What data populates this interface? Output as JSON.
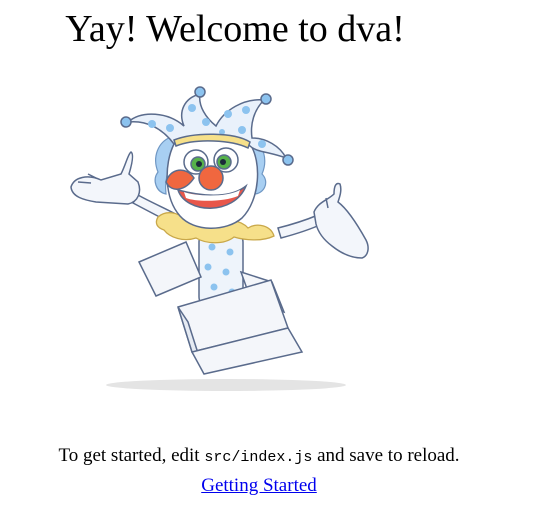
{
  "page": {
    "title": "Yay! Welcome to dva!"
  },
  "intro": {
    "prefix": "To get started, edit ",
    "code": "src/index.js",
    "suffix": " and save to reload."
  },
  "link": {
    "label": "Getting Started"
  },
  "illustration": {
    "icon": "jester-in-box-icon",
    "colors": {
      "outline": "#5a6b8c",
      "hat": "#e9f1fb",
      "dots": "#8cc3ef",
      "hair": "#a8cff2",
      "nose": "#f0673f",
      "collar": "#f6e08a",
      "eyes": "#56b24a",
      "box": "#f4f6fa",
      "shadow": "#e4e4e4"
    }
  }
}
